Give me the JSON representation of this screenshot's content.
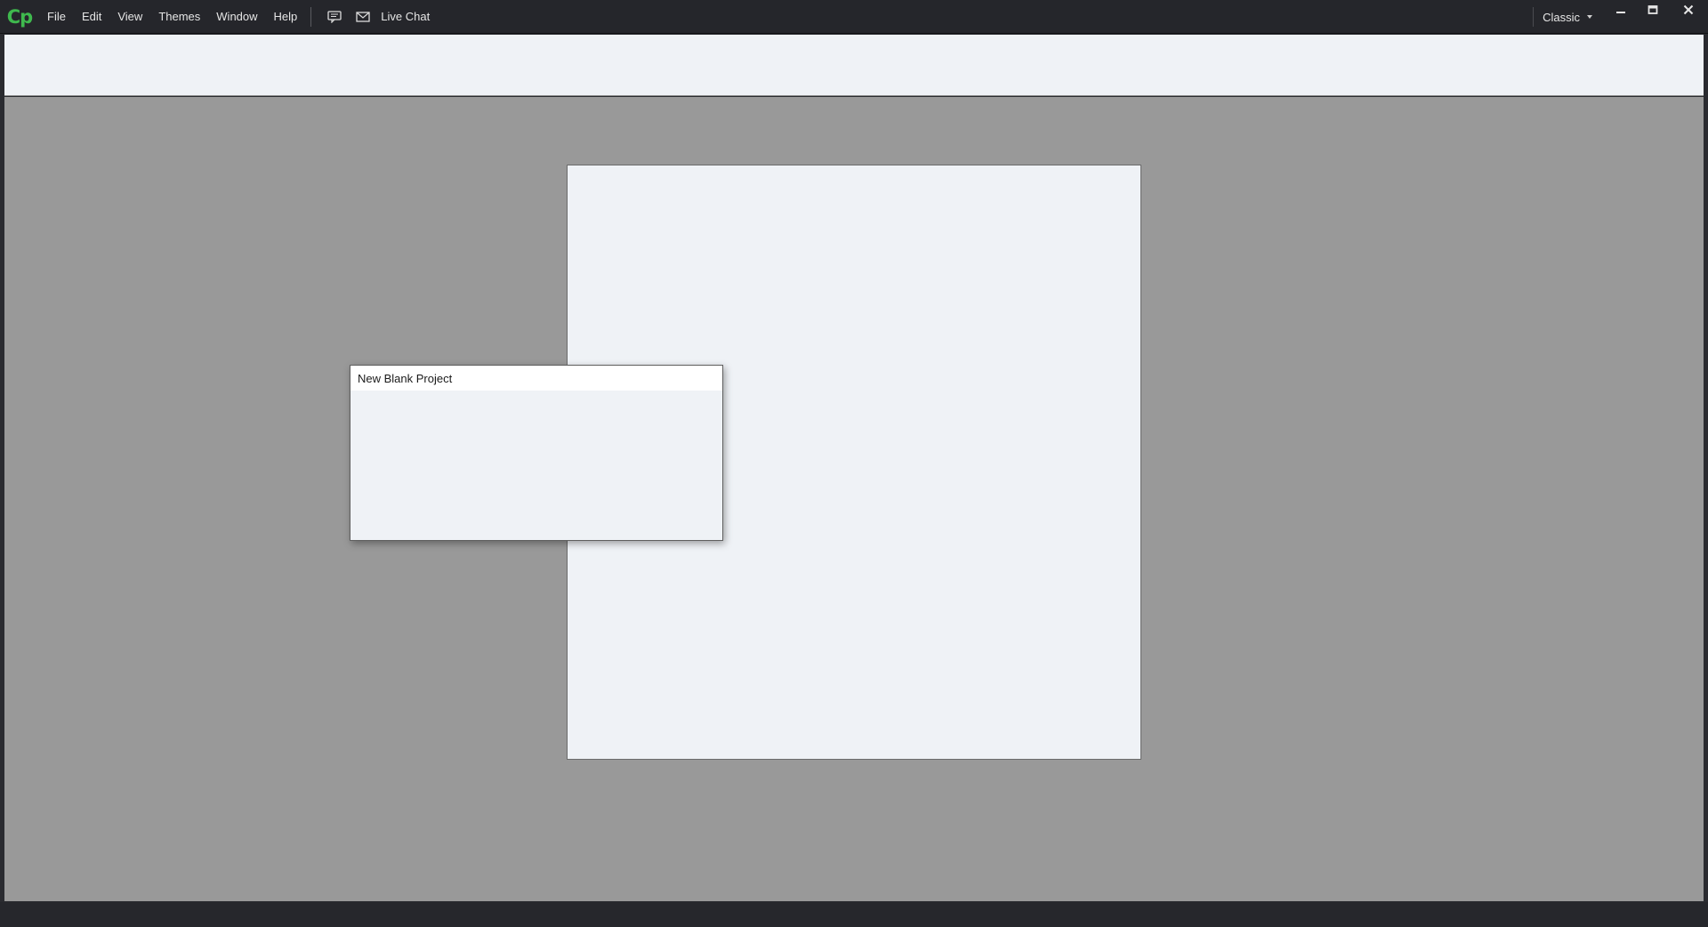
{
  "app": {
    "logo_text": "Cp",
    "accent_color": "#3fb94e"
  },
  "menu": {
    "items": [
      "File",
      "Edit",
      "View",
      "Themes",
      "Window",
      "Help"
    ],
    "feedback_icon": "chat-bubble-icon",
    "email_icon": "envelope-icon",
    "live_chat_label": "Live Chat"
  },
  "workspace": {
    "selected": "Classic"
  },
  "window_controls": {
    "minimize_icon": "minimize-icon",
    "maximize_icon": "maximize-icon",
    "close_icon": "close-icon"
  },
  "dialog": {
    "title": "New Blank Project"
  },
  "colors": {
    "stage_background": "#999999",
    "canvas_background": "#eff2f6",
    "titlebar_background": "#25262b"
  }
}
